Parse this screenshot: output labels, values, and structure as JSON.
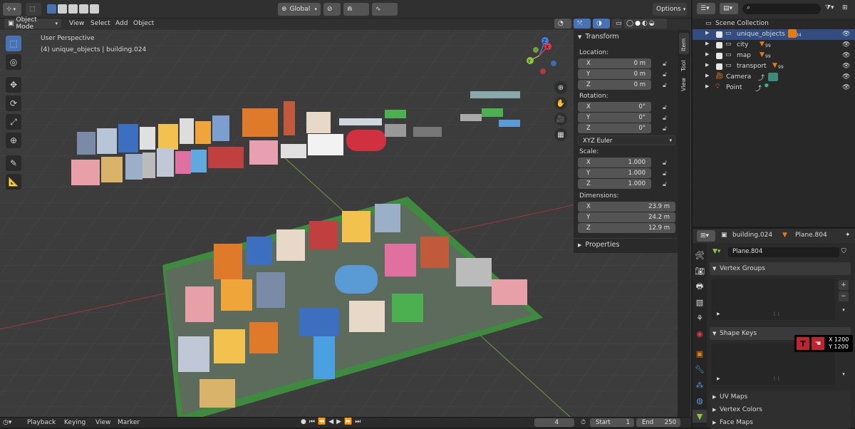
{
  "header": {
    "orientation_label": "Global",
    "options_label": "Options"
  },
  "viewport_bar": {
    "mode_label": "Object Mode",
    "menus": [
      "View",
      "Select",
      "Add",
      "Object"
    ]
  },
  "viewport": {
    "perspective_label": "User Perspective",
    "selection_label": "(4) unique_objects | building.024",
    "gizmo_axes": [
      "X",
      "Y",
      "Z"
    ]
  },
  "npanel": {
    "title": "Transform",
    "location_label": "Location:",
    "location": [
      {
        "axis": "X",
        "value": "0 m"
      },
      {
        "axis": "Y",
        "value": "0 m"
      },
      {
        "axis": "Z",
        "value": "0 m"
      }
    ],
    "rotation_label": "Rotation:",
    "rotation": [
      {
        "axis": "X",
        "value": "0°"
      },
      {
        "axis": "Y",
        "value": "0°"
      },
      {
        "axis": "Z",
        "value": "0°"
      }
    ],
    "rotation_mode": "XYZ Euler",
    "scale_label": "Scale:",
    "scale": [
      {
        "axis": "X",
        "value": "1.000"
      },
      {
        "axis": "Y",
        "value": "1.000"
      },
      {
        "axis": "Z",
        "value": "1.000"
      }
    ],
    "dimensions_label": "Dimensions:",
    "dimensions": [
      {
        "axis": "X",
        "value": "23.9 m"
      },
      {
        "axis": "Y",
        "value": "24.2 m"
      },
      {
        "axis": "Z",
        "value": "12.9 m"
      }
    ],
    "properties_label": "Properties",
    "tabs": [
      "Item",
      "Tool",
      "View"
    ]
  },
  "outliner": {
    "scene_collection": "Scene Collection",
    "rows": [
      {
        "name": "unique_objects",
        "count": "34"
      },
      {
        "name": "city",
        "count": "99"
      },
      {
        "name": "map",
        "count": "99"
      },
      {
        "name": "transport",
        "count": "99"
      },
      {
        "name": "Camera",
        "count": ""
      },
      {
        "name": "Point",
        "count": ""
      }
    ]
  },
  "properties": {
    "object_name": "building.024",
    "mesh_name": "Plane.804",
    "data_field": "Plane.804",
    "vertex_groups": "Vertex Groups",
    "shape_keys": "Shape Keys",
    "uv_maps": "UV Maps",
    "vertex_colors": "Vertex Colors",
    "face_maps": "Face Maps"
  },
  "overlay_readout": {
    "x": "X 1200",
    "y": "Y 1200"
  },
  "timeline": {
    "menus": [
      "Playback",
      "Keying",
      "View",
      "Marker"
    ],
    "current_frame": "4",
    "start_label": "Start",
    "start_value": "1",
    "end_label": "End",
    "end_value": "250"
  },
  "colors": {
    "accent_blue": "#4772b3",
    "axis_x": "#e2384b",
    "axis_y": "#8cc63f",
    "axis_z": "#3b82e0",
    "orange": "#e87d0d"
  }
}
